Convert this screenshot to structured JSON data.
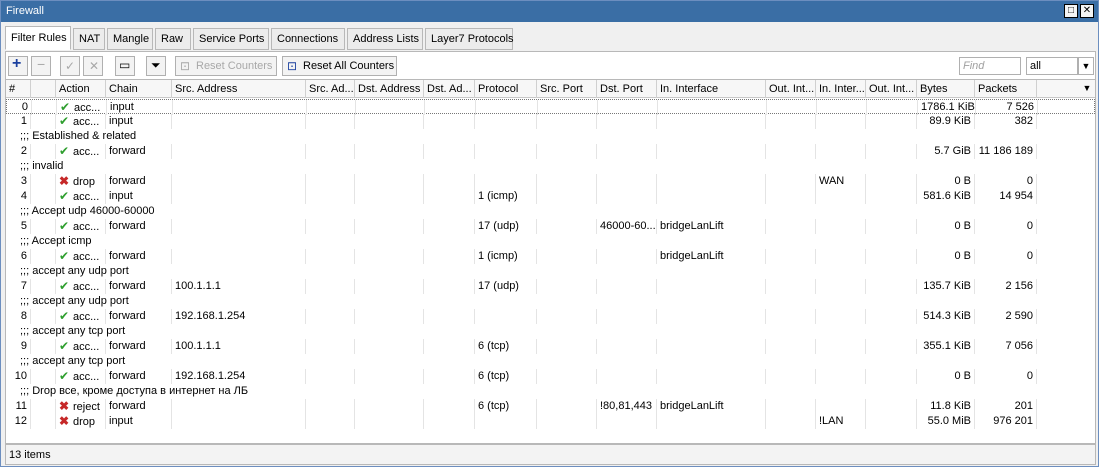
{
  "window": {
    "title": "Firewall"
  },
  "tabs": [
    "Filter Rules",
    "NAT",
    "Mangle",
    "Raw",
    "Service Ports",
    "Connections",
    "Address Lists",
    "Layer7 Protocols"
  ],
  "toolbar": {
    "reset_counters": "Reset Counters",
    "reset_all_counters": "Reset All Counters",
    "find_placeholder": "Find",
    "filter_value": "all"
  },
  "columns": [
    "#",
    "",
    "Action",
    "Chain",
    "Src. Address",
    "Src. Ad...",
    "Dst. Address",
    "Dst. Ad...",
    "Protocol",
    "Src. Port",
    "Dst. Port",
    "In. Interface",
    "Out. Int...",
    "In. Inter...",
    "Out. Int...",
    "Bytes",
    "Packets"
  ],
  "rows": [
    {
      "num": "0",
      "action": "acc...",
      "action_type": "accept",
      "chain": "input",
      "bytes": "1786.1 KiB",
      "packets": "7 526"
    },
    {
      "num": "1",
      "action": "acc...",
      "action_type": "accept",
      "chain": "input",
      "bytes": "89.9 KiB",
      "packets": "382"
    },
    {
      "comment": ";;; Established & related"
    },
    {
      "num": "2",
      "action": "acc...",
      "action_type": "accept",
      "chain": "forward",
      "bytes": "5.7 GiB",
      "packets": "11 186 189"
    },
    {
      "comment": ";;; invalid"
    },
    {
      "num": "3",
      "action": "drop",
      "action_type": "drop",
      "chain": "forward",
      "in_inter": "WAN",
      "bytes": "0 B",
      "packets": "0"
    },
    {
      "num": "4",
      "action": "acc...",
      "action_type": "accept",
      "chain": "input",
      "protocol": "1 (icmp)",
      "bytes": "581.6 KiB",
      "packets": "14 954"
    },
    {
      "comment": ";;; Accept udp 46000-60000"
    },
    {
      "num": "5",
      "action": "acc...",
      "action_type": "accept",
      "chain": "forward",
      "protocol": "17 (udp)",
      "dst_port": "46000-60...",
      "in_interface": "bridgeLanLift",
      "bytes": "0 B",
      "packets": "0"
    },
    {
      "comment": ";;; Accept icmp"
    },
    {
      "num": "6",
      "action": "acc...",
      "action_type": "accept",
      "chain": "forward",
      "protocol": "1 (icmp)",
      "in_interface": "bridgeLanLift",
      "bytes": "0 B",
      "packets": "0"
    },
    {
      "comment": ";;; accept any udp port"
    },
    {
      "num": "7",
      "action": "acc...",
      "action_type": "accept",
      "chain": "forward",
      "src_address": "100.1.1.1",
      "protocol": "17 (udp)",
      "bytes": "135.7 KiB",
      "packets": "2 156"
    },
    {
      "comment": ";;; accept any udp port"
    },
    {
      "num": "8",
      "action": "acc...",
      "action_type": "accept",
      "chain": "forward",
      "src_address": "192.168.1.254",
      "bytes": "514.3 KiB",
      "packets": "2 590"
    },
    {
      "comment": ";;; accept any tcp port"
    },
    {
      "num": "9",
      "action": "acc...",
      "action_type": "accept",
      "chain": "forward",
      "src_address": "100.1.1.1",
      "protocol": "6 (tcp)",
      "bytes": "355.1 KiB",
      "packets": "7 056"
    },
    {
      "comment": ";;; accept any tcp port"
    },
    {
      "num": "10",
      "action": "acc...",
      "action_type": "accept",
      "chain": "forward",
      "src_address": "192.168.1.254",
      "protocol": "6 (tcp)",
      "bytes": "0 B",
      "packets": "0"
    },
    {
      "comment": ";;; Drop все, кроме доступа в интернет на ЛБ"
    },
    {
      "num": "11",
      "action": "reject",
      "action_type": "drop",
      "chain": "forward",
      "protocol": "6 (tcp)",
      "dst_port": "!80,81,443",
      "in_interface": "bridgeLanLift",
      "bytes": "11.8 KiB",
      "packets": "201"
    },
    {
      "num": "12",
      "action": "drop",
      "action_type": "drop",
      "chain": "input",
      "in_inter": "!LAN",
      "bytes": "55.0 MiB",
      "packets": "976 201"
    }
  ],
  "status": {
    "items": "13 items"
  },
  "colors": {
    "title_bar": "#3a6ea5",
    "accept_icon": "#2e9e2e",
    "drop_icon": "#c62828",
    "add_icon": "#1a3f9e"
  }
}
